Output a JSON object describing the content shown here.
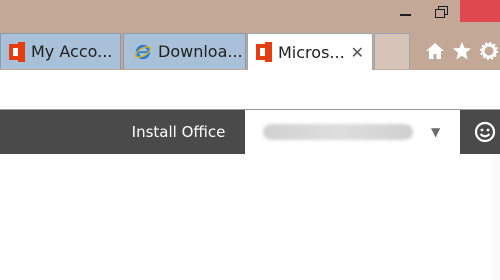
{
  "window": {
    "minimize_icon": "minimize-icon",
    "restore_icon": "restore-icon",
    "close_icon": "close-icon"
  },
  "tabs": [
    {
      "label": "My Acco...",
      "icon": "office-icon",
      "active": false
    },
    {
      "label": "Downloa...",
      "icon": "internet-explorer-icon",
      "active": false
    },
    {
      "label": "Micros...",
      "icon": "office-icon",
      "active": true,
      "close": "✕"
    }
  ],
  "toolbar": {
    "home_icon": "home-icon",
    "favorites_icon": "star-icon",
    "settings_icon": "gear-icon"
  },
  "office_nav": {
    "install_label": "Install Office",
    "account_dropdown_icon": "caret-down-icon",
    "feedback_icon": "smiley-icon"
  },
  "colors": {
    "titlebar": "#c3a797",
    "inactive_tab": "#a9c1d8",
    "nav_bar": "#4a4a4a",
    "close_button": "#e0484f",
    "office_red": "#e43d0f"
  }
}
